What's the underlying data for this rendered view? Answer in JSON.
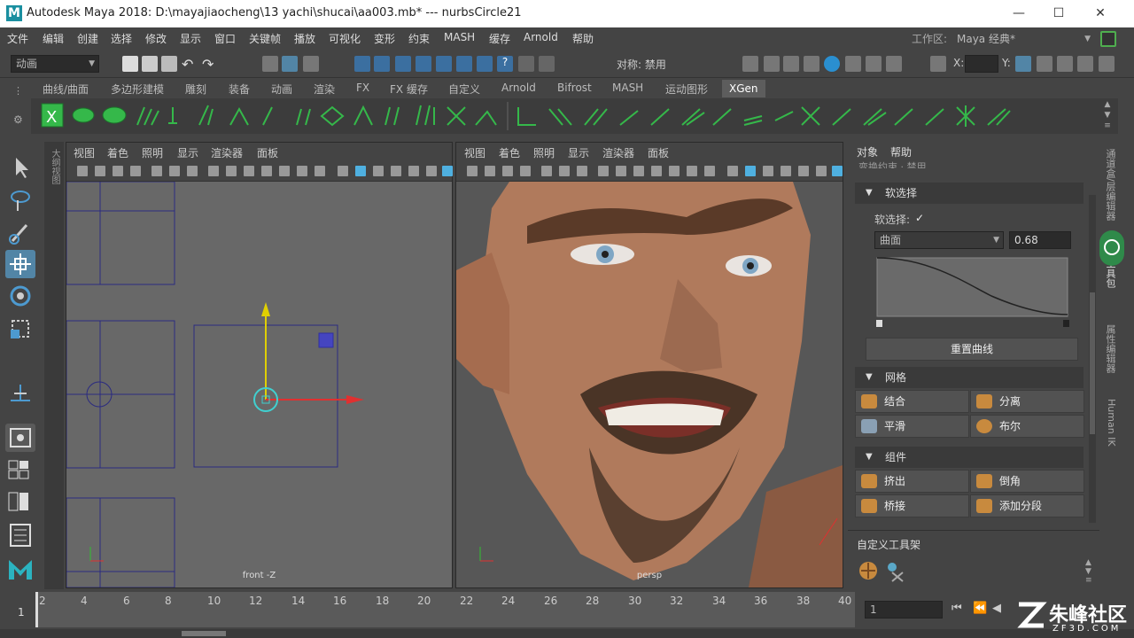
{
  "titlebar": {
    "title": "Autodesk Maya 2018: D:\\mayajiaocheng\\13 yachi\\shucai\\aa003.mb*   ---   nurbsCircle21",
    "logo": "M"
  },
  "menubar": {
    "items": [
      "文件",
      "编辑",
      "创建",
      "选择",
      "修改",
      "显示",
      "窗口",
      "关键帧",
      "播放",
      "可视化",
      "变形",
      "约束",
      "MASH",
      "缓存",
      "Arnold",
      "帮助"
    ],
    "workspace_label": "工作区:",
    "workspace_value": "Maya 经典*"
  },
  "statusline": {
    "mode": "动画",
    "symmetry": "对称: 禁用",
    "x_label": "X:",
    "y_label": "Y:"
  },
  "shelf_tabs": [
    "曲线/曲面",
    "多边形建模",
    "雕刻",
    "装备",
    "动画",
    "渲染",
    "FX",
    "FX 缓存",
    "自定义",
    "Arnold",
    "Bifrost",
    "MASH",
    "运动图形",
    "XGen"
  ],
  "shelf_active": "XGen",
  "outliner_strip_label": "大纲视图",
  "viewports": {
    "menu": [
      "视图",
      "着色",
      "照明",
      "显示",
      "渲染器",
      "面板"
    ],
    "front_camera": "front -Z",
    "persp_camera": "persp"
  },
  "rightpanel": {
    "tabs": [
      "对象",
      "帮助"
    ],
    "cut_text": "变换约束 · 禁用",
    "soft_section": "软选择",
    "soft_label": "软选择:",
    "soft_checked": "✓",
    "falloff_mode": "曲面",
    "falloff_value": "0.68",
    "reset_curve": "重置曲线",
    "mesh_section": "网格",
    "mesh_buttons": [
      "结合",
      "分离",
      "平滑",
      "布尔"
    ],
    "component_section": "组件",
    "component_buttons": [
      "挤出",
      "倒角",
      "桥接",
      "添加分段"
    ],
    "custom_shelf": "自定义工具架"
  },
  "vertical_tabs": [
    "通道盒/层编辑器",
    "建模工具包",
    "属性编辑器",
    "Human IK"
  ],
  "timeline": {
    "ticks": [
      "2",
      "4",
      "6",
      "8",
      "10",
      "12",
      "14",
      "16",
      "18",
      "20",
      "22",
      "24",
      "26",
      "28",
      "30",
      "32",
      "34",
      "36",
      "38",
      "40"
    ],
    "current_frame": "1",
    "start_frame": "1"
  },
  "watermark": {
    "brand": "朱峰社区",
    "url": "ZF3D.COM"
  },
  "colors": {
    "accent": "#5285a6",
    "shelf_green": "#35b84a",
    "skin": "#b07a5c"
  }
}
